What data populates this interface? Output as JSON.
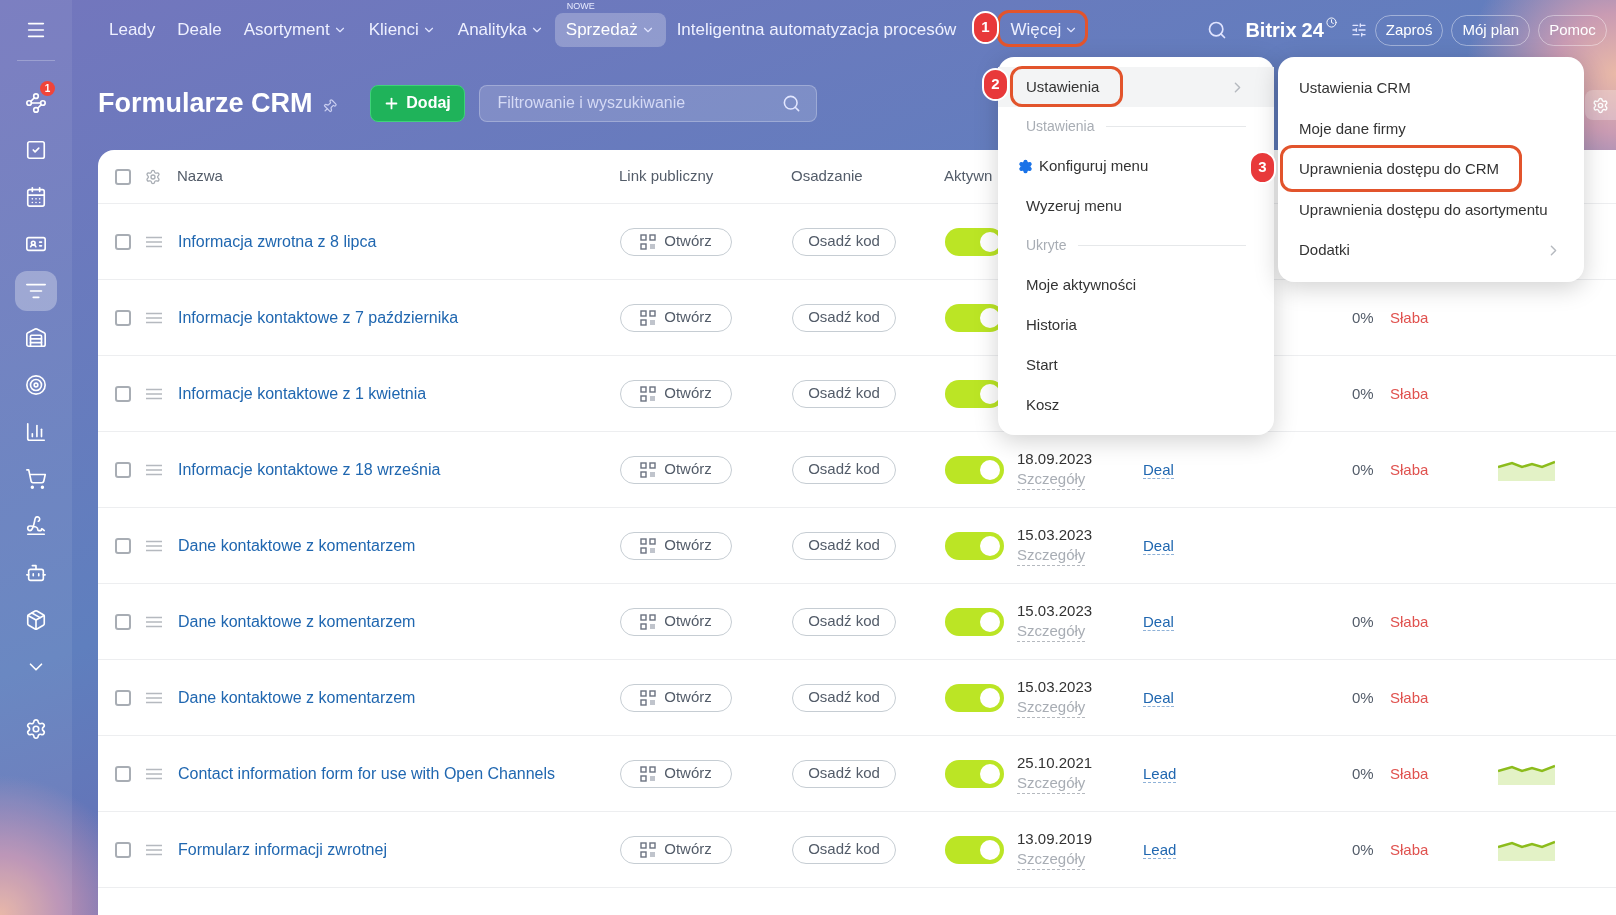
{
  "nav": {
    "items": [
      {
        "label": "Leady",
        "dropdown": false,
        "selected": false
      },
      {
        "label": "Deale",
        "dropdown": false,
        "selected": false
      },
      {
        "label": "Asortyment",
        "dropdown": true,
        "selected": false
      },
      {
        "label": "Klienci",
        "dropdown": true,
        "selected": false
      },
      {
        "label": "Analityka",
        "dropdown": true,
        "selected": false
      },
      {
        "label": "Sprzedaż",
        "dropdown": true,
        "selected": true,
        "badge": "NOWE"
      },
      {
        "label": "Inteligentna automatyzacja procesów",
        "dropdown": false,
        "selected": false
      },
      {
        "label": "Więcej",
        "dropdown": true,
        "selected": false
      }
    ]
  },
  "header_right": {
    "logo": "Bitrix",
    "logo_number": "24",
    "buttons": [
      "Zaproś",
      "Mój plan",
      "Pomoc"
    ]
  },
  "sidebar": {
    "items": [
      {
        "kind": "menu",
        "selected": false
      },
      {
        "kind": "network",
        "selected": false,
        "badge": "1"
      },
      {
        "kind": "task",
        "selected": false
      },
      {
        "kind": "calendar",
        "selected": false
      },
      {
        "kind": "contact",
        "selected": false
      },
      {
        "kind": "funnel",
        "selected": true
      },
      {
        "kind": "warehouse",
        "selected": false
      },
      {
        "kind": "target",
        "selected": false
      },
      {
        "kind": "chart",
        "selected": false
      },
      {
        "kind": "cart",
        "selected": false
      },
      {
        "kind": "sign",
        "selected": false
      },
      {
        "kind": "robot",
        "selected": false
      },
      {
        "kind": "box",
        "selected": false
      },
      {
        "kind": "more",
        "selected": false
      },
      {
        "kind": "settings",
        "selected": false
      }
    ]
  },
  "page": {
    "title": "Formularze CRM",
    "add_button": "Dodaj",
    "search": {
      "placeholder": "Filtrowanie i wyszukiwanie"
    }
  },
  "table": {
    "select_all_checked": false,
    "columns": [
      "Nazwa",
      "Link publiczny",
      "Osadzanie",
      "Aktywn"
    ],
    "rows": [
      {
        "checked": false,
        "name": "Informacja zwrotna z 8 lipca",
        "link_button": "Otwórz",
        "embed_button": "Osadź kod",
        "active": true
      },
      {
        "checked": false,
        "name": "Informacje kontaktowe z 7 października",
        "link_button": "Otwórz",
        "embed_button": "Osadź kod",
        "active": true,
        "conversion": "0%",
        "rating": "Słaba"
      },
      {
        "checked": false,
        "name": "Informacje kontaktowe z 1 kwietnia",
        "link_button": "Otwórz",
        "embed_button": "Osadź kod",
        "active": true,
        "conversion": "0%",
        "rating": "Słaba"
      },
      {
        "checked": false,
        "name": "Informacje kontaktowe z 18 września",
        "link_button": "Otwórz",
        "embed_button": "Osadź kod",
        "active": true,
        "date": "18.09.2023",
        "details": "Szczegóły",
        "type": "Deal",
        "conversion": "0%",
        "rating": "Słaba",
        "trend": true
      },
      {
        "checked": false,
        "name": "Dane kontaktowe z komentarzem",
        "link_button": "Otwórz",
        "embed_button": "Osadź kod",
        "active": true,
        "date": "15.03.2023",
        "details": "Szczegóły",
        "type": "Deal"
      },
      {
        "checked": false,
        "name": "Dane kontaktowe z komentarzem",
        "link_button": "Otwórz",
        "embed_button": "Osadź kod",
        "active": true,
        "date": "15.03.2023",
        "details": "Szczegóły",
        "type": "Deal",
        "conversion": "0%",
        "rating": "Słaba"
      },
      {
        "checked": false,
        "name": "Dane kontaktowe z komentarzem",
        "link_button": "Otwórz",
        "embed_button": "Osadź kod",
        "active": true,
        "date": "15.03.2023",
        "details": "Szczegóły",
        "type": "Deal",
        "conversion": "0%",
        "rating": "Słaba"
      },
      {
        "checked": false,
        "name": "Contact information form for use with Open Channels",
        "link_button": "Otwórz",
        "embed_button": "Osadź kod",
        "active": true,
        "date": "25.10.2021",
        "details": "Szczegóły",
        "type": "Lead",
        "conversion": "0%",
        "rating": "Słaba",
        "trend": true
      },
      {
        "checked": false,
        "name": "Formularz informacji zwrotnej",
        "link_button": "Otwórz",
        "embed_button": "Osadź kod",
        "active": true,
        "date": "13.09.2019",
        "details": "Szczegóły",
        "type": "Lead",
        "conversion": "0%",
        "rating": "Słaba",
        "trend": true
      }
    ]
  },
  "menu": {
    "items": [
      {
        "kind": "item",
        "label": "Ustawienia",
        "selected": true,
        "submenu": true
      },
      {
        "kind": "section",
        "label": "Ustawienia"
      },
      {
        "kind": "config",
        "label": "Konfiguruj menu",
        "selected": false,
        "submenu": false
      },
      {
        "kind": "item",
        "label": "Wyzeruj menu",
        "selected": false,
        "submenu": false
      },
      {
        "kind": "section",
        "label": "Ukryte"
      },
      {
        "kind": "item",
        "label": "Moje aktywności",
        "selected": false,
        "submenu": false
      },
      {
        "kind": "item",
        "label": "Historia",
        "selected": false,
        "submenu": false
      },
      {
        "kind": "item",
        "label": "Start",
        "selected": false,
        "submenu": false
      },
      {
        "kind": "item",
        "label": "Kosz",
        "selected": false,
        "submenu": false
      }
    ]
  },
  "submenu": {
    "items": [
      {
        "label": "Ustawienia CRM",
        "submenu": false
      },
      {
        "label": "Moje dane firmy",
        "submenu": false
      },
      {
        "label": "Uprawnienia dostępu do CRM",
        "submenu": false
      },
      {
        "label": "Uprawnienia dostępu do asortymentu",
        "submenu": false
      },
      {
        "label": "Dodatki",
        "submenu": true
      }
    ]
  },
  "annotations": [
    {
      "number": "1"
    },
    {
      "number": "2"
    },
    {
      "number": "3"
    }
  ]
}
